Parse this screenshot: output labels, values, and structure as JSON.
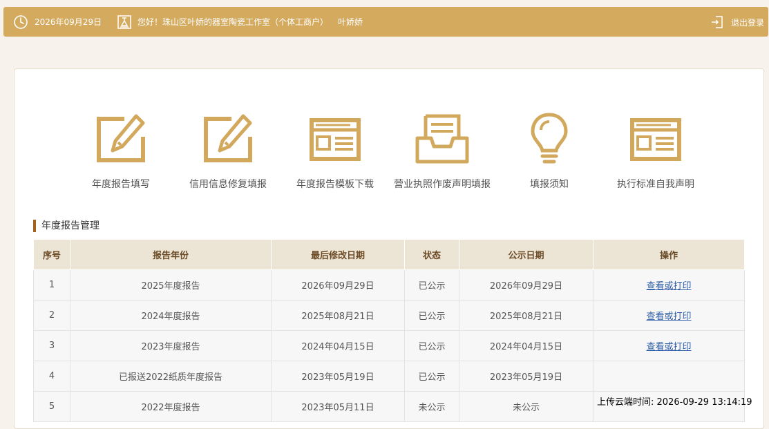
{
  "header": {
    "date": "2026年09月29日",
    "greeting": "您好！珠山区叶娇的器室陶瓷工作室（个体工商户）",
    "user_name": "叶娇娇",
    "logout_label": "退出登录"
  },
  "features": [
    {
      "label": "年度报告填写",
      "icon": "edit-icon"
    },
    {
      "label": "信用信息修复填报",
      "icon": "edit-icon"
    },
    {
      "label": "年度报告模板下载",
      "icon": "template-icon"
    },
    {
      "label": "营业执照作废声明填报",
      "icon": "inbox-icon"
    },
    {
      "label": "填报须知",
      "icon": "lightbulb-icon"
    },
    {
      "label": "执行标准自我声明",
      "icon": "template-icon"
    }
  ],
  "section_title": "年度报告管理",
  "table": {
    "headers": [
      "序号",
      "报告年份",
      "最后修改日期",
      "状态",
      "公示日期",
      "操作"
    ],
    "rows": [
      {
        "no": "1",
        "year": "2025年度报告",
        "modified": "2026年09月29日",
        "status": "已公示",
        "publish": "2026年09月29日",
        "action": "查看或打印"
      },
      {
        "no": "2",
        "year": "2024年度报告",
        "modified": "2025年08月21日",
        "status": "已公示",
        "publish": "2025年08月21日",
        "action": "查看或打印"
      },
      {
        "no": "3",
        "year": "2023年度报告",
        "modified": "2024年04月15日",
        "status": "已公示",
        "publish": "2024年04月15日",
        "action": "查看或打印"
      },
      {
        "no": "4",
        "year": "已报送2022纸质年度报告",
        "modified": "2023年05月19日",
        "status": "已公示",
        "publish": "2023年05月19日",
        "action": ""
      },
      {
        "no": "5",
        "year": "2022年度报告",
        "modified": "2023年05月11日",
        "status": "未公示",
        "publish": "未公示",
        "action": ""
      }
    ]
  },
  "overlay_text": "上传云端时间: 2026-09-29 13:14:19",
  "colors": {
    "header_bg": "#d4aa5f",
    "icon_gold": "#d2a85c",
    "section_accent": "#a0621e",
    "table_head_bg": "#ece4d5",
    "link": "#2f5fa7"
  }
}
